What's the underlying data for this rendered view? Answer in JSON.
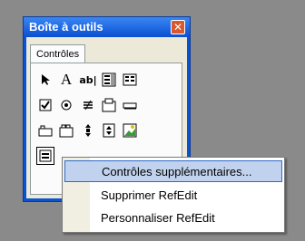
{
  "window": {
    "title": "Boîte à outils",
    "close_glyph": "✕"
  },
  "tabs": [
    {
      "label": "Contrôles"
    }
  ],
  "tools": {
    "pointer": "arrow-icon",
    "label": "A",
    "textbox": "ab|",
    "combobox": "combobox-icon",
    "listbox": "listbox-icon",
    "checkbox": "checkbox-icon",
    "option": "radio-icon",
    "toggle": "toggle-icon",
    "frame": "frame-icon",
    "button": "command-button-icon",
    "tabstrip": "tabstrip-icon",
    "multipage": "multipage-icon",
    "scrollbar": "scrollbar-icon",
    "spin": "spin-icon",
    "image": "image-icon",
    "refedit": "refedit-icon"
  },
  "context_menu": {
    "items": [
      {
        "label": "Contrôles supplémentaires...",
        "highlighted": true
      },
      {
        "label": "Supprimer RefEdit"
      },
      {
        "label": "Personnaliser RefEdit"
      }
    ]
  },
  "colors": {
    "titlebar": "#0a53d1",
    "highlight": "#c1d2ee"
  }
}
